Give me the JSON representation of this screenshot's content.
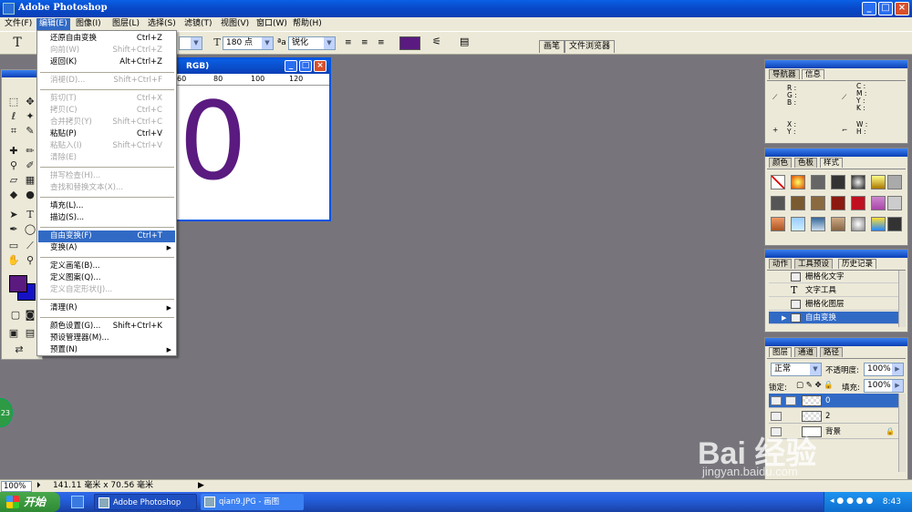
{
  "app": {
    "title": "Adobe Photoshop",
    "colors": {
      "xp_blue": "#0a3fb5",
      "highlight": "#316ac5",
      "text_color": "#5a1a80",
      "workspace": "#77757b"
    }
  },
  "menubar": {
    "items": [
      "文件(F)",
      "编辑(E)",
      "图像(I)",
      "图层(L)",
      "选择(S)",
      "滤镜(T)",
      "视图(V)",
      "窗口(W)",
      "帮助(H)"
    ],
    "active": "编辑(E)"
  },
  "options": {
    "font_size": "180 点",
    "aa_mode": "锐化",
    "tabs": [
      "画笔",
      "文件浏览器"
    ]
  },
  "document": {
    "title_fragment": "RGB)",
    "ruler": [
      "60",
      "80",
      "100",
      "120"
    ],
    "glyph": "0"
  },
  "edit_menu": {
    "items": [
      {
        "label": "还原自由变换",
        "shortcut": "Ctrl+Z",
        "state": "enabled"
      },
      {
        "label": "向前(W)",
        "shortcut": "Shift+Ctrl+Z",
        "state": "disabled"
      },
      {
        "label": "返回(K)",
        "shortcut": "Alt+Ctrl+Z",
        "state": "enabled"
      },
      {
        "label": "消褪(D)...",
        "shortcut": "Shift+Ctrl+F",
        "state": "disabled"
      },
      {
        "label": "剪切(T)",
        "shortcut": "Ctrl+X",
        "state": "disabled"
      },
      {
        "label": "拷贝(C)",
        "shortcut": "Ctrl+C",
        "state": "disabled"
      },
      {
        "label": "合并拷贝(Y)",
        "shortcut": "Shift+Ctrl+C",
        "state": "disabled"
      },
      {
        "label": "粘贴(P)",
        "shortcut": "Ctrl+V",
        "state": "enabled"
      },
      {
        "label": "粘贴入(I)",
        "shortcut": "Shift+Ctrl+V",
        "state": "disabled"
      },
      {
        "label": "清除(E)",
        "shortcut": "",
        "state": "disabled"
      },
      {
        "label": "拼写检查(H)...",
        "shortcut": "",
        "state": "disabled"
      },
      {
        "label": "查找和替换文本(X)...",
        "shortcut": "",
        "state": "disabled"
      },
      {
        "label": "填充(L)...",
        "shortcut": "",
        "state": "enabled"
      },
      {
        "label": "描边(S)...",
        "shortcut": "",
        "state": "enabled"
      },
      {
        "label": "自由变换(F)",
        "shortcut": "Ctrl+T",
        "state": "highlighted"
      },
      {
        "label": "变换(A)",
        "shortcut": "",
        "state": "submenu"
      },
      {
        "label": "定义画笔(B)...",
        "shortcut": "",
        "state": "enabled"
      },
      {
        "label": "定义图案(Q)...",
        "shortcut": "",
        "state": "enabled"
      },
      {
        "label": "定义自定形状(J)...",
        "shortcut": "",
        "state": "disabled"
      },
      {
        "label": "清理(R)",
        "shortcut": "",
        "state": "submenu"
      },
      {
        "label": "颜色设置(G)...",
        "shortcut": "Shift+Ctrl+K",
        "state": "enabled"
      },
      {
        "label": "预设管理器(M)...",
        "shortcut": "",
        "state": "enabled"
      },
      {
        "label": "预置(N)",
        "shortcut": "",
        "state": "submenu"
      }
    ]
  },
  "panels": {
    "navigator": {
      "tabs": [
        "导航器",
        "信息"
      ]
    },
    "info": {
      "rgb": [
        "R :",
        "G :",
        "B :"
      ],
      "cmyk": [
        "C :",
        "M :",
        "Y :",
        "K :"
      ],
      "xy": [
        "X :",
        "Y :"
      ],
      "wh": [
        "W :",
        "H :"
      ]
    },
    "color": {
      "tabs": [
        "颜色",
        "色板",
        "样式"
      ]
    },
    "history": {
      "tabs": [
        "动作",
        "工具预设",
        "历史记录"
      ],
      "items": [
        "栅格化文字",
        "文字工具",
        "栅格化图层",
        "自由变换"
      ]
    },
    "layers": {
      "tabs": [
        "图层",
        "通道",
        "路径"
      ],
      "blend_mode": "正常",
      "opacity_label": "不透明度:",
      "opacity": "100%",
      "lock_label": "锁定:",
      "fill_label": "填充:",
      "fill": "100%",
      "items": [
        "0",
        "2",
        "背景"
      ]
    }
  },
  "status": {
    "zoom": "100%",
    "doc_info": "141.11 毫米 x 70.56 毫米"
  },
  "taskbar": {
    "start": "开始",
    "tasks": [
      "Adobe Photoshop",
      "qian9.JPG - 画图"
    ],
    "clock": "8:43"
  },
  "watermark": {
    "main": "Bai 经验",
    "sub": "jingyan.baidu.com"
  },
  "badge": "23"
}
